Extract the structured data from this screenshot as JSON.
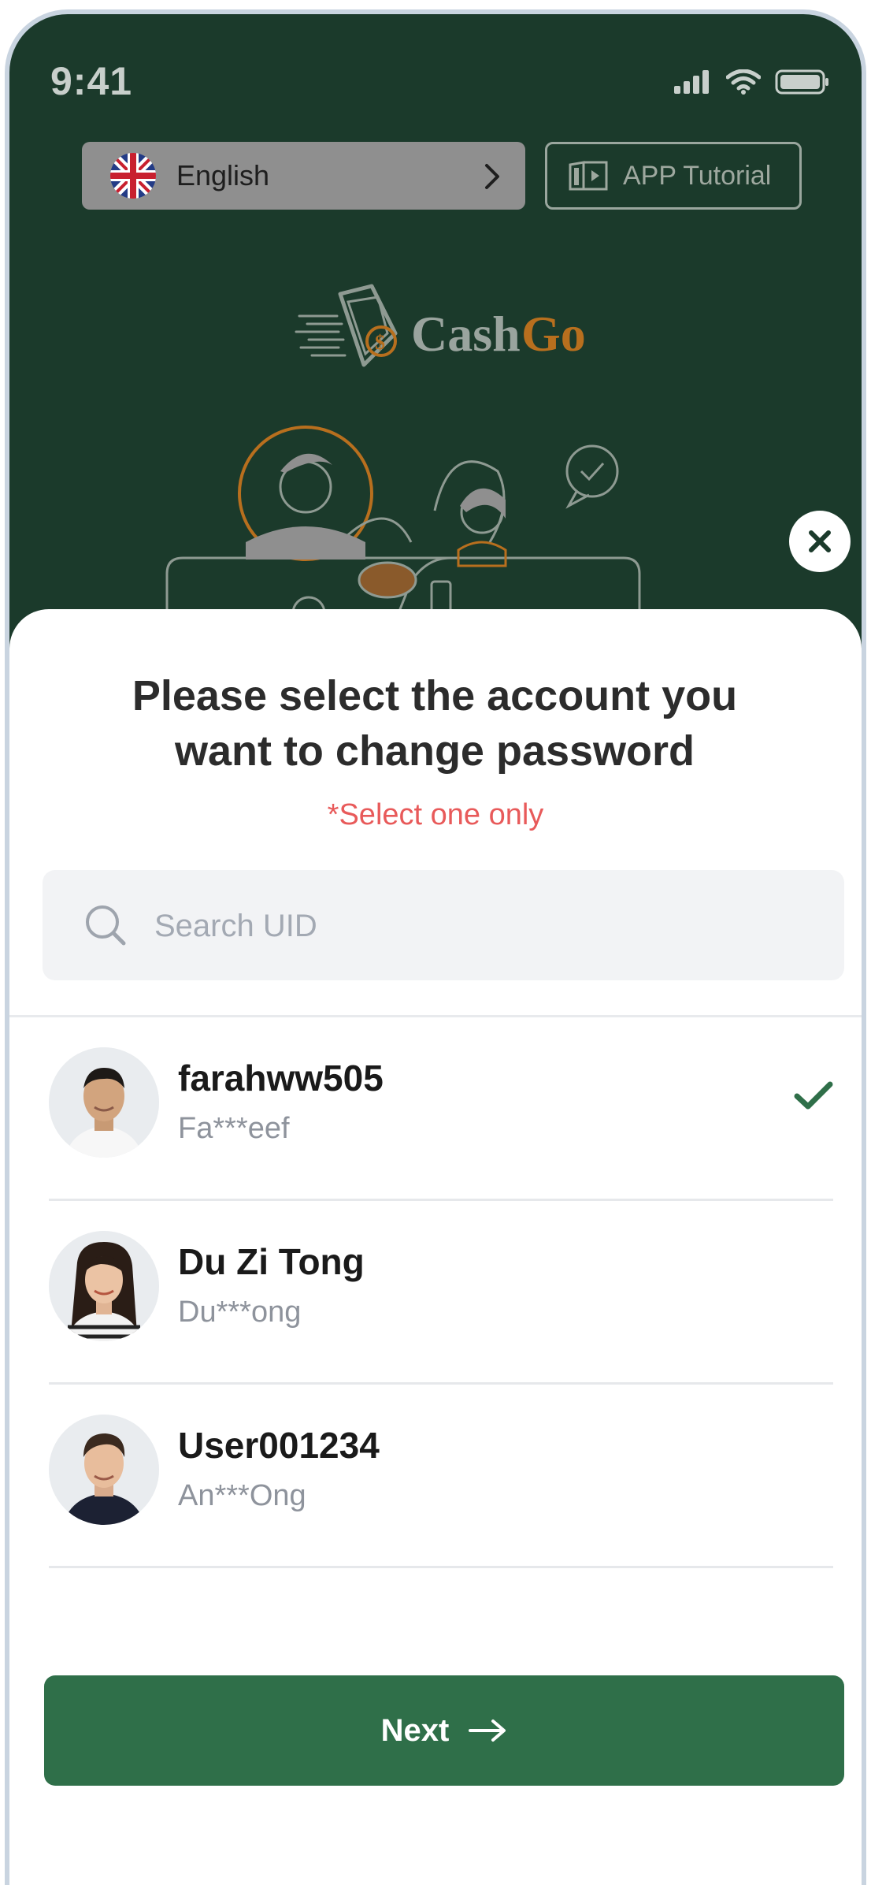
{
  "status_bar": {
    "time": "9:41"
  },
  "header": {
    "language_label": "English",
    "tutorial_label": "APP Tutorial"
  },
  "brand": {
    "name_part1": "Cash",
    "name_part2": "Go"
  },
  "sheet": {
    "title": "Please select the account you want to change password",
    "subtitle": "*Select one only",
    "search": {
      "placeholder": "Search UID",
      "value": ""
    },
    "accounts": [
      {
        "uid": "farahww505",
        "name": "Fa***eef",
        "selected": true
      },
      {
        "uid": "Du Zi Tong",
        "name": "Du***ong",
        "selected": false
      },
      {
        "uid": "User001234",
        "name": "An***Ong",
        "selected": false
      }
    ],
    "next_label": "Next"
  },
  "colors": {
    "background_dark": "#1b3a2b",
    "accent_green": "#2f6f49",
    "brand_orange": "#b86f1e",
    "warning_red": "#e85a5a"
  },
  "icons": [
    "uk-flag-icon",
    "chevron-right-icon",
    "book-video-icon",
    "close-icon",
    "search-icon",
    "check-icon",
    "arrow-right-icon",
    "signal-icon",
    "wifi-icon",
    "battery-icon"
  ]
}
